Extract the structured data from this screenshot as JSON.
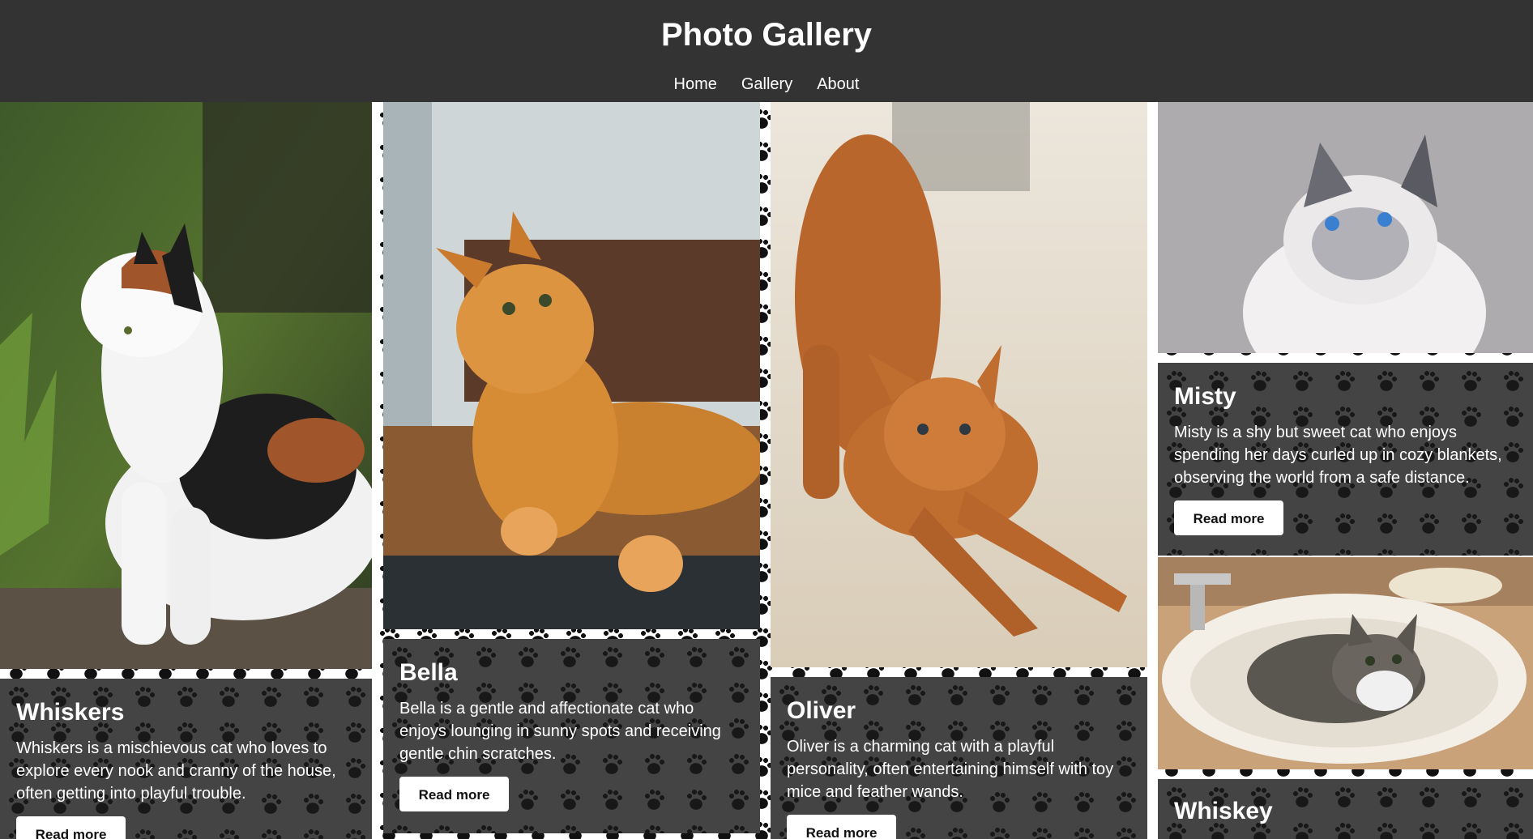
{
  "header": {
    "title": "Photo Gallery",
    "nav": [
      "Home",
      "Gallery",
      "About"
    ]
  },
  "gallery": {
    "cards": [
      {
        "name": "Whiskers",
        "description": "Whiskers is a mischievous cat who loves to explore every nook and cranny of the house, often getting into playful trouble.",
        "button": "Read more",
        "photo_subject": "calico cat standing in grass"
      },
      {
        "name": "Bella",
        "description": "Bella is a gentle and affectionate cat who enjoys lounging in sunny spots and receiving gentle chin scratches.",
        "button": "Read more",
        "photo_subject": "orange long-haired cat lying on a table"
      },
      {
        "name": "Oliver",
        "description": "Oliver is a charming cat with a playful personality, often entertaining himself with toy mice and feather wands.",
        "button": "Read more",
        "photo_subject": "orange cat stretching on a wooden floor"
      },
      {
        "name": "Misty",
        "description": "Misty is a shy but sweet cat who enjoys spending her days curled up in cozy blankets, observing the world from a safe distance.",
        "button": "Read more",
        "photo_subject": "white siamese-like cat with blue eyes"
      },
      {
        "name": "Whiskey",
        "description": "",
        "button": "",
        "photo_subject": "tabby cat sitting in a bathroom sink"
      }
    ]
  },
  "colors": {
    "header_bg": "#333333",
    "caption_bg": "#444444",
    "paw_print": "#111111",
    "button_bg": "#ffffff"
  }
}
